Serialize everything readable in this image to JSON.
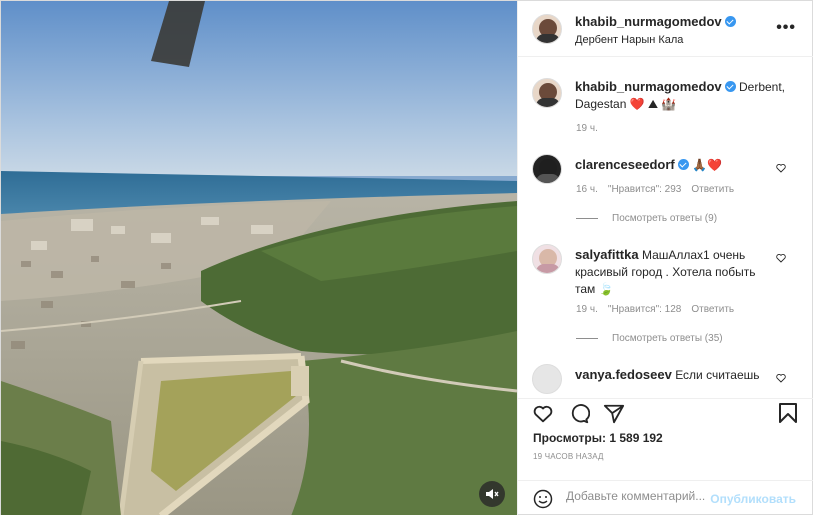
{
  "post": {
    "username": "khabib_nurmagomedov",
    "location": "Дербент Нарын Кала"
  },
  "caption": {
    "username": "khabib_nurmagomedov",
    "text_line1": "Derbent,",
    "text_line2": "Dagestan",
    "emoji": "❤️ ⛰ 🏰",
    "time": "19 ч."
  },
  "comments": [
    {
      "username": "clarenceseedorf",
      "text": "🙏🏾❤️",
      "time": "16 ч.",
      "likes": "\"Нравится\": 293",
      "reply": "Ответить",
      "view_replies": "Посмотреть ответы (9)"
    },
    {
      "username": "salyafittka",
      "text_line1": "МашАллах1 очень",
      "text_line2": "красивый город . Хотела побыть",
      "text_line3": "там 🍃",
      "time": "19 ч.",
      "likes": "\"Нравится\": 128",
      "reply": "Ответить",
      "view_replies": "Посмотреть ответы (35)"
    },
    {
      "username": "vanya.fedoseev",
      "text": "Если считаешь"
    }
  ],
  "actions": {
    "views": "Просмотры: 1 589 192",
    "timestamp": "19 ЧАСОВ НАЗАД"
  },
  "add_comment": {
    "placeholder": "Добавьте комментарий...",
    "publish": "Опубликовать"
  },
  "colors": {
    "accent": "#3897f0",
    "like_red": "#ed4956",
    "publish_disabled": "#b2dffc"
  }
}
